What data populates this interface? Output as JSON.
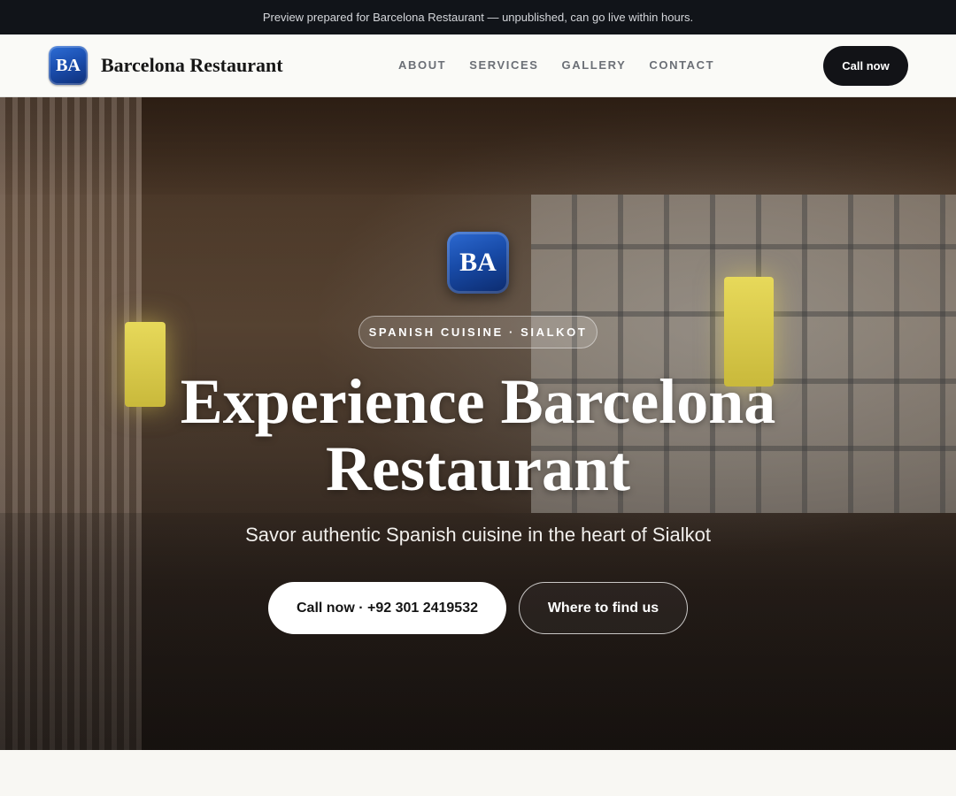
{
  "preview_bar": {
    "text": "Preview prepared for Barcelona Restaurant — unpublished, can go live within hours."
  },
  "header": {
    "logo_initials": "BA",
    "brand_name": "Barcelona Restaurant",
    "nav": [
      {
        "label": "ABOUT"
      },
      {
        "label": "SERVICES"
      },
      {
        "label": "GALLERY"
      },
      {
        "label": "CONTACT"
      }
    ],
    "cta_label": "Call now"
  },
  "hero": {
    "logo_initials": "BA",
    "eyebrow": "SPANISH CUISINE · SIALKOT",
    "title_line1": "Experience Barcelona",
    "title_line2": "Restaurant",
    "subtitle": "Savor authentic Spanish cuisine in the heart of Sialkot",
    "primary_button": "Call now · +92 301 2419532",
    "secondary_button": "Where to find us"
  },
  "colors": {
    "top_bar": "#111419",
    "header_bg": "#fafaf7",
    "logo_blue": "#1b4fb0",
    "cta_dark": "#121317",
    "page_bg": "#f8f7f3"
  }
}
